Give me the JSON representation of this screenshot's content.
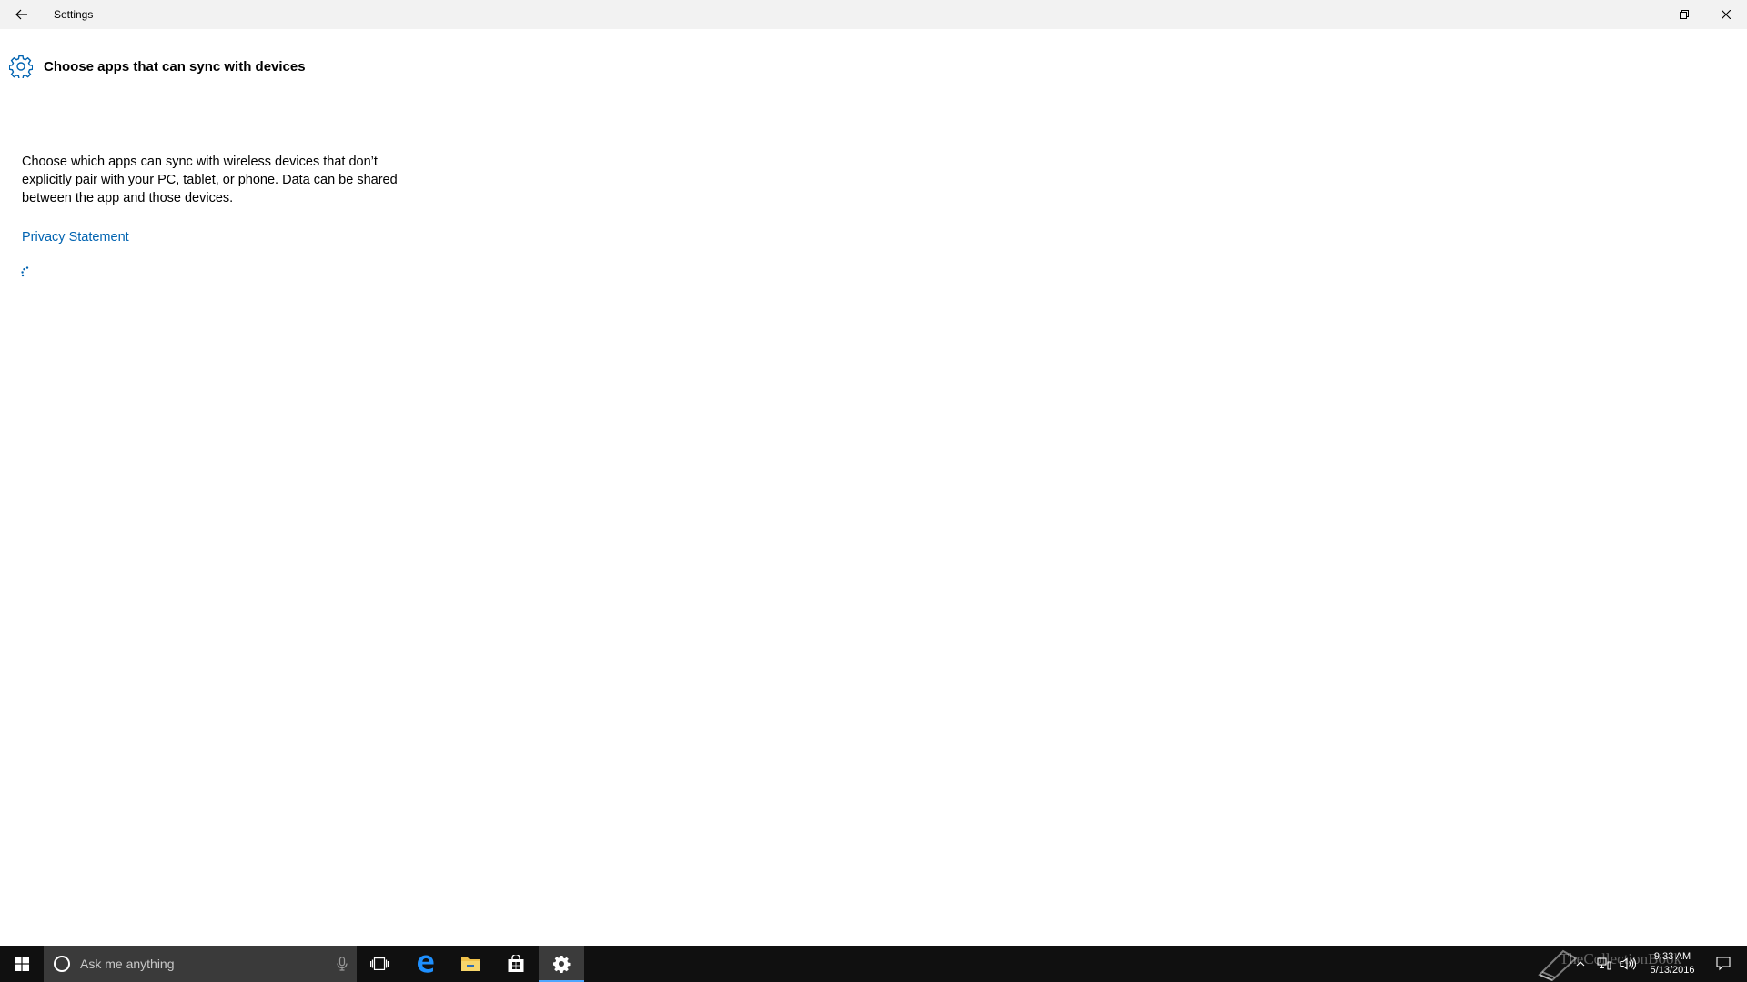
{
  "window": {
    "title": "Settings"
  },
  "page": {
    "title": "Choose apps that can sync with devices",
    "description": "Choose which apps can sync with wireless devices that don’t explicitly pair with your PC, tablet, or phone. Data can be shared between the app and those devices.",
    "privacy_link": "Privacy Statement"
  },
  "taskbar": {
    "search_placeholder": "Ask me anything",
    "apps": [
      "task-view",
      "edge",
      "file-explorer",
      "store",
      "settings"
    ],
    "active_app": "settings",
    "clock_time": "9:33 AM",
    "clock_date": "5/13/2016",
    "watermark": "TheCollectionBook"
  },
  "colors": {
    "accent": "#0063b1",
    "titlebar_bg": "#f2f2f2",
    "taskbar_bg": "#101010",
    "search_bg": "#3a3a3a",
    "active_indicator": "#4da6ff"
  }
}
